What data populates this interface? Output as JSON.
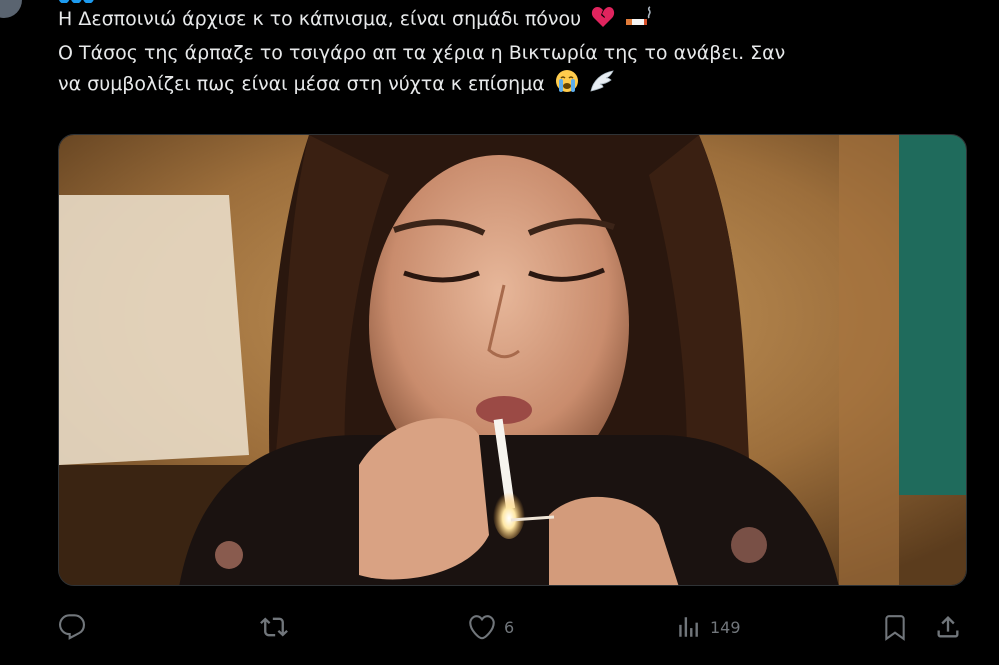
{
  "tweet": {
    "lines": [
      "Η Δεσποινιώ άρχισε κ το κάπνισμα, είναι σημάδι πόνου",
      "Ο Τάσος της άρπαζε το τσιγάρο απ τα χέρια η Βικτωρία της το ανάβει. Σαν",
      "να συμβολίζει πως είναι μέσα στη νύχτα κ επίσημα"
    ],
    "emojis": {
      "line1": [
        "broken-heart-icon",
        "cigarette-icon"
      ],
      "line3": [
        "crying-face-icon",
        "wing-icon"
      ]
    }
  },
  "media": {
    "description_icon": "video-still-image",
    "colors": {
      "background_warm": "#b8894f",
      "teal_panel": "#1f6b5c"
    }
  },
  "actions": {
    "reply": {
      "icon": "reply-icon",
      "count": ""
    },
    "retweet": {
      "icon": "retweet-icon",
      "count": ""
    },
    "like": {
      "icon": "heart-icon",
      "count": "6"
    },
    "views": {
      "icon": "views-icon",
      "count": "149"
    },
    "bookmark": {
      "icon": "bookmark-icon"
    },
    "share": {
      "icon": "share-icon"
    }
  },
  "colors": {
    "background": "#000000",
    "text": "#e7e9ea",
    "muted": "#71767b",
    "accent": "#1d9bf0"
  }
}
